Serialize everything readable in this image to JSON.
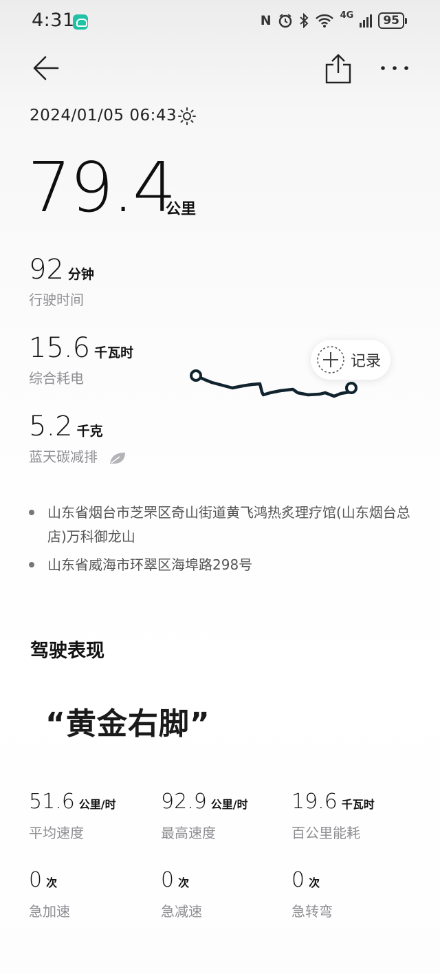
{
  "status_bar": {
    "time": "4:31",
    "nfc": "N",
    "network": "4G",
    "battery": "95"
  },
  "trip": {
    "date": "2024/01/05 06:43",
    "distance": "79.4",
    "distance_unit": "公里",
    "duration": {
      "value": "92",
      "unit": "分钟",
      "label": "行驶时间"
    },
    "energy": {
      "value": "15.6",
      "unit": "千瓦时",
      "label": "综合耗电"
    },
    "carbon": {
      "value": "5.2",
      "unit": "千克",
      "label": "蓝天碳减排"
    },
    "record_label": "记录",
    "addresses": [
      "山东省烟台市芝罘区奇山街道黄飞鸿热炙理疗馆(山东烟台总店)万科御龙山",
      "山东省威海市环翠区海埠路298号"
    ]
  },
  "performance": {
    "title": "驾驶表现",
    "quote": "“黄金右脚”",
    "stats": [
      {
        "value": "51.6",
        "unit": "公里/时",
        "label": "平均速度"
      },
      {
        "value": "92.9",
        "unit": "公里/时",
        "label": "最高速度"
      },
      {
        "value": "19.6",
        "unit": "千瓦时",
        "label": "百公里能耗"
      },
      {
        "value": "0",
        "unit": "次",
        "label": "急加速"
      },
      {
        "value": "0",
        "unit": "次",
        "label": "急减速"
      },
      {
        "value": "0",
        "unit": "次",
        "label": "急转弯"
      }
    ]
  },
  "colors": {
    "route": "#11232e",
    "label_gray": "#8e8e93"
  }
}
